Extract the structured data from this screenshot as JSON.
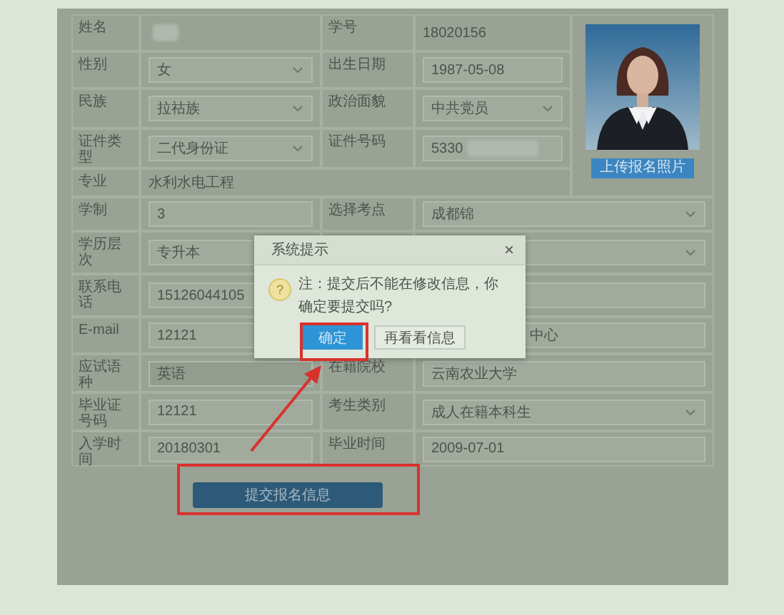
{
  "form": {
    "rows": [
      {
        "left": {
          "label": "姓名",
          "kind": "plain",
          "redacted": true
        },
        "right": {
          "label": "学号",
          "kind": "plain",
          "value": "18020156"
        }
      },
      {
        "left": {
          "label": "性别",
          "kind": "select",
          "value": "女"
        },
        "right": {
          "label": "出生日期",
          "kind": "input",
          "value": "1987-05-08"
        }
      },
      {
        "left": {
          "label": "民族",
          "kind": "select",
          "value": "拉祜族"
        },
        "right": {
          "label": "政治面貌",
          "kind": "select",
          "value": "中共党员"
        }
      },
      {
        "left": {
          "label": "证件类型",
          "kind": "select",
          "value": "二代身份证"
        },
        "right": {
          "label": "证件号码",
          "kind": "input",
          "value": "5330",
          "redacted": true
        }
      },
      {
        "left": {
          "label": "专业",
          "kind": "plain",
          "value": "水利水电工程"
        }
      },
      {
        "left": {
          "label": "学制",
          "kind": "input",
          "value": "3"
        },
        "right": {
          "label": "选择考点",
          "kind": "select",
          "value": "成都锦"
        }
      },
      {
        "left": {
          "label": "学历层次",
          "kind": "select",
          "value": "专升本"
        },
        "right": {
          "kind": "select"
        }
      },
      {
        "left": {
          "label": "联系电话",
          "kind": "input",
          "value": "15126044105"
        },
        "right": {
          "kind": "input"
        }
      },
      {
        "left": {
          "label": "E-mail",
          "kind": "input",
          "value": "12121"
        },
        "right": {
          "kind": "input",
          "value": "中心"
        }
      },
      {
        "left": {
          "label": "应试语种",
          "kind": "readonly",
          "value": "英语"
        },
        "right": {
          "label": "在籍院校",
          "kind": "input",
          "value": "云南农业大学"
        }
      },
      {
        "left": {
          "label": "毕业证号码",
          "kind": "input",
          "value": "12121"
        },
        "right": {
          "label": "考生类别",
          "kind": "select",
          "value": "成人在籍本科生"
        }
      },
      {
        "left": {
          "label": "入学时间",
          "kind": "input",
          "value": "20180301"
        },
        "right": {
          "label": "毕业时间",
          "kind": "input",
          "value": "2009-07-01"
        }
      }
    ]
  },
  "photo": {
    "kind": "picture",
    "upload_button": "上传报名照片"
  },
  "submit_button": "提交报名信息",
  "dialog": {
    "title": "系统提示",
    "close": "×",
    "icon": "?",
    "message": "注：提交后不能在修改信息，你确定要提交吗?",
    "buttons": [
      {
        "label": "确定",
        "selected": true
      },
      {
        "label": "再看看信息",
        "selected": false
      }
    ]
  }
}
